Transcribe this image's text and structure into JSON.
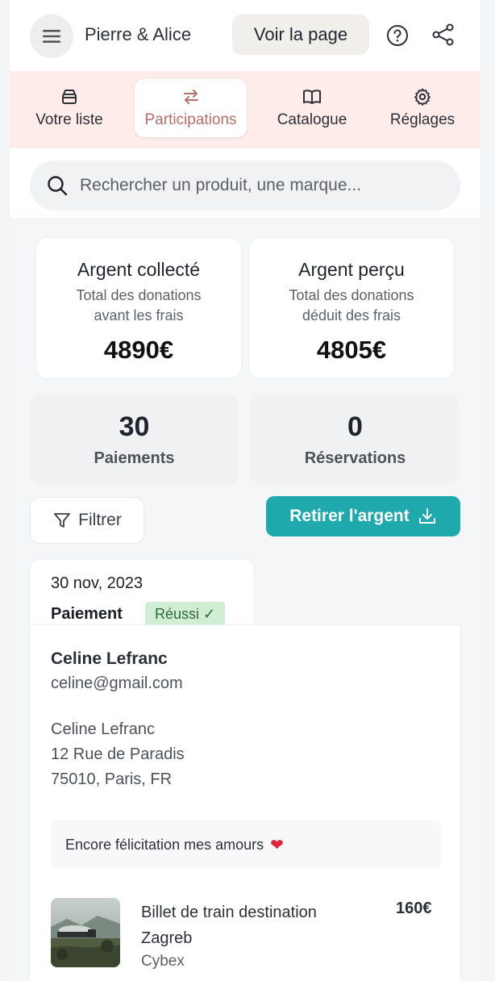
{
  "header": {
    "title": "Pierre & Alice",
    "view_button": "Voir la page",
    "menu_icon": "hamburger-icon",
    "help_icon": "help-circle-icon",
    "share_icon": "share-icon"
  },
  "tabs": [
    {
      "label": "Votre liste",
      "icon": "box-icon",
      "active": false
    },
    {
      "label": "Participations",
      "icon": "swap-arrows-icon",
      "active": true
    },
    {
      "label": "Catalogue",
      "icon": "book-open-icon",
      "active": false
    },
    {
      "label": "Réglages",
      "icon": "gear-icon",
      "active": false
    }
  ],
  "search": {
    "placeholder": "Rechercher un produit, une marque..."
  },
  "stats": {
    "collected": {
      "title": "Argent collecté",
      "subtitle_1": "Total des donations",
      "subtitle_2": "avant les frais",
      "value": "4890€"
    },
    "received": {
      "title": "Argent perçu",
      "subtitle_1": "Total des donations",
      "subtitle_2": "déduit des frais",
      "value": "4805€"
    },
    "payments": {
      "value": "30",
      "label": "Paiements"
    },
    "reservations": {
      "value": "0",
      "label": "Réservations"
    }
  },
  "actions": {
    "filter_label": "Filtrer",
    "withdraw_label": "Retirer l'argent"
  },
  "transaction": {
    "date": "30 nov, 2023",
    "type": "Paiement",
    "status": "Réussi ✓",
    "name": "Celine Lefranc",
    "email": "celine@gmail.com",
    "address": {
      "line1": "Celine Lefranc",
      "line2": "12 Rue de Paradis",
      "line3": "75010, Paris, FR"
    },
    "message": "Encore félicitation mes amours",
    "product": {
      "title": "Billet de train destination Zagreb",
      "brand": "Cybex",
      "price": "160€"
    }
  },
  "colors": {
    "accent": "#1fa9ac",
    "tabs_bg": "#fdecea",
    "active_tab_text": "#b86d6a",
    "success_bg": "#cfeed4"
  }
}
